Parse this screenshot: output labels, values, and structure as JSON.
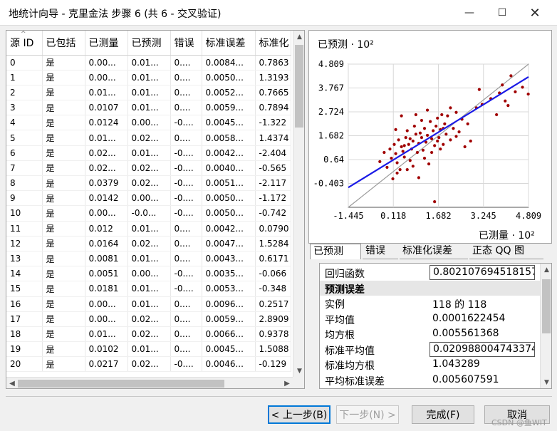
{
  "window": {
    "title": "地统计向导 - 克里金法 步骤 6 (共 6 - 交叉验证)",
    "minimize": "—",
    "maximize": "☐",
    "close": "✕"
  },
  "table": {
    "columns": [
      "源 ID",
      "已包括",
      "已测量",
      "已预测",
      "错误",
      "标准误差",
      "标准化"
    ],
    "rows": [
      [
        "0",
        "是",
        "0.00...",
        "0.01...",
        "0....",
        "0.0084...",
        "0.7863"
      ],
      [
        "1",
        "是",
        "0.00...",
        "0.01...",
        "0....",
        "0.0050...",
        "1.3193"
      ],
      [
        "2",
        "是",
        "0.01...",
        "0.01...",
        "0....",
        "0.0052...",
        "0.7665"
      ],
      [
        "3",
        "是",
        "0.0107",
        "0.01...",
        "0....",
        "0.0059...",
        "0.7894"
      ],
      [
        "4",
        "是",
        "0.0124",
        "0.00...",
        "-0....",
        "0.0045...",
        "-1.322"
      ],
      [
        "5",
        "是",
        "0.01...",
        "0.02...",
        "0....",
        "0.0058...",
        "1.4374"
      ],
      [
        "6",
        "是",
        "0.02...",
        "0.01...",
        "-0....",
        "0.0042...",
        "-2.404"
      ],
      [
        "7",
        "是",
        "0.02...",
        "0.02...",
        "-0....",
        "0.0040...",
        "-0.565"
      ],
      [
        "8",
        "是",
        "0.0379",
        "0.02...",
        "-0....",
        "0.0051...",
        "-2.117"
      ],
      [
        "9",
        "是",
        "0.0142",
        "0.00...",
        "-0....",
        "0.0050...",
        "-1.172"
      ],
      [
        "10",
        "是",
        "0.00...",
        "-0.0...",
        "-0....",
        "0.0050...",
        "-0.742"
      ],
      [
        "11",
        "是",
        "0.012",
        "0.01...",
        "0....",
        "0.0042...",
        "0.0790"
      ],
      [
        "12",
        "是",
        "0.0164",
        "0.02...",
        "0....",
        "0.0047...",
        "1.5284"
      ],
      [
        "13",
        "是",
        "0.0081",
        "0.01...",
        "0....",
        "0.0043...",
        "0.6171"
      ],
      [
        "14",
        "是",
        "0.0051",
        "0.00...",
        "-0....",
        "0.0035...",
        "-0.066"
      ],
      [
        "15",
        "是",
        "0.0181",
        "0.01...",
        "-0....",
        "0.0053...",
        "-0.348"
      ],
      [
        "16",
        "是",
        "0.00...",
        "0.01...",
        "0....",
        "0.0096...",
        "0.2517"
      ],
      [
        "17",
        "是",
        "0.00...",
        "0.02...",
        "0....",
        "0.0059...",
        "2.8909"
      ],
      [
        "18",
        "是",
        "0.01...",
        "0.02...",
        "0....",
        "0.0066...",
        "0.9378"
      ],
      [
        "19",
        "是",
        "0.0102",
        "0.01...",
        "0....",
        "0.0045...",
        "1.5088"
      ],
      [
        "20",
        "是",
        "0.0217",
        "0.02...",
        "-0....",
        "0.0046...",
        "-0.129"
      ]
    ],
    "sort_indicator": "^"
  },
  "chart_data": {
    "type": "scatter",
    "ylabel": "已预测",
    "xlabel": "已测量",
    "y_multiplier": "· 10²",
    "x_multiplier": "· 10²",
    "x_ticks": [
      "-1.445",
      "0.118",
      "1.682",
      "3.245",
      "4.809"
    ],
    "y_ticks": [
      "4.809",
      "3.767",
      "2.724",
      "1.682",
      "0.64",
      "-0.403"
    ],
    "xlim": [
      -1.445,
      4.809
    ],
    "ylim": [
      -1.445,
      4.809
    ],
    "regression_line": {
      "from": [
        -1.445,
        -0.58
      ],
      "to": [
        4.809,
        4.25
      ]
    },
    "reference_line": {
      "from": [
        -1.445,
        -1.445
      ],
      "to": [
        4.809,
        4.809
      ]
    },
    "points": [
      [
        -0.35,
        0.55
      ],
      [
        -0.2,
        0.95
      ],
      [
        -0.1,
        0.3
      ],
      [
        0.0,
        1.1
      ],
      [
        0.05,
        0.7
      ],
      [
        0.1,
        -0.2
      ],
      [
        0.15,
        1.3
      ],
      [
        0.2,
        0.9
      ],
      [
        0.25,
        0.5
      ],
      [
        0.3,
        1.5
      ],
      [
        0.35,
        0.2
      ],
      [
        0.4,
        1.2
      ],
      [
        0.45,
        1.0
      ],
      [
        0.5,
        0.75
      ],
      [
        0.55,
        1.6
      ],
      [
        0.6,
        1.9
      ],
      [
        0.65,
        1.3
      ],
      [
        0.7,
        0.6
      ],
      [
        0.75,
        1.1
      ],
      [
        0.8,
        1.45
      ],
      [
        0.85,
        2.1
      ],
      [
        0.9,
        1.75
      ],
      [
        0.95,
        0.95
      ],
      [
        1.0,
        1.35
      ],
      [
        1.05,
        1.8
      ],
      [
        1.1,
        1.6
      ],
      [
        1.15,
        1.05
      ],
      [
        1.2,
        2.0
      ],
      [
        1.25,
        1.4
      ],
      [
        1.3,
        1.7
      ],
      [
        1.35,
        0.45
      ],
      [
        1.4,
        2.3
      ],
      [
        1.45,
        1.55
      ],
      [
        1.5,
        1.9
      ],
      [
        1.55,
        1.25
      ],
      [
        1.6,
        2.1
      ],
      [
        1.65,
        2.45
      ],
      [
        1.7,
        1.6
      ],
      [
        1.75,
        1.95
      ],
      [
        1.8,
        2.6
      ],
      [
        1.85,
        1.3
      ],
      [
        1.9,
        2.2
      ],
      [
        1.95,
        1.75
      ],
      [
        2.0,
        2.55
      ],
      [
        2.1,
        1.5
      ],
      [
        2.2,
        2.0
      ],
      [
        2.3,
        2.7
      ],
      [
        2.4,
        1.85
      ],
      [
        2.5,
        2.4
      ],
      [
        2.6,
        1.2
      ],
      [
        2.7,
        2.2
      ],
      [
        2.8,
        1.45
      ],
      [
        1.0,
        -0.15
      ],
      [
        0.6,
        0.2
      ],
      [
        0.9,
        2.6
      ],
      [
        1.3,
        2.8
      ],
      [
        1.55,
        -1.2
      ],
      [
        0.2,
        1.95
      ],
      [
        1.2,
        0.7
      ],
      [
        1.75,
        1.1
      ],
      [
        3.0,
        2.9
      ],
      [
        3.2,
        3.05
      ],
      [
        3.1,
        3.7
      ],
      [
        3.5,
        3.3
      ],
      [
        3.8,
        3.55
      ],
      [
        3.7,
        2.6
      ],
      [
        4.0,
        3.2
      ],
      [
        4.2,
        4.3
      ],
      [
        4.6,
        3.8
      ],
      [
        4.8,
        3.5
      ],
      [
        4.35,
        3.6
      ],
      [
        3.9,
        3.9
      ],
      [
        4.1,
        3.0
      ],
      [
        0.4,
        2.55
      ],
      [
        1.1,
        2.35
      ],
      [
        2.1,
        2.9
      ],
      [
        0.7,
        1.55
      ],
      [
        2.3,
        1.65
      ],
      [
        1.45,
        0.95
      ],
      [
        0.5,
        1.25
      ],
      [
        1.65,
        1.45
      ],
      [
        0.25,
        0.05
      ],
      [
        1.85,
        2.0
      ],
      [
        0.8,
        0.35
      ]
    ],
    "grid": true
  },
  "tabs": [
    "已预测",
    "错误",
    "标准化误差",
    "正态 QQ 图"
  ],
  "properties": {
    "rows": [
      {
        "key": "回归函数",
        "value": "0.802107694518157 ...",
        "boxed": true
      },
      {
        "key": "预测误差",
        "value": "",
        "section": true
      },
      {
        "key": "实例",
        "value": "118 的 118"
      },
      {
        "key": "平均值",
        "value": "0.0001622454"
      },
      {
        "key": "均方根",
        "value": "0.005561368"
      },
      {
        "key": "标准平均值",
        "value": "0.020988004743374...",
        "boxed": true
      },
      {
        "key": "标准均方根",
        "value": "1.043289"
      },
      {
        "key": "平均标准误差",
        "value": "0.005607591"
      }
    ]
  },
  "buttons": {
    "back": "< 上一步(B)",
    "next": "下一步(N) >",
    "finish": "完成(F)",
    "cancel": "取消"
  },
  "watermark": "CSDN @鱼WIT"
}
